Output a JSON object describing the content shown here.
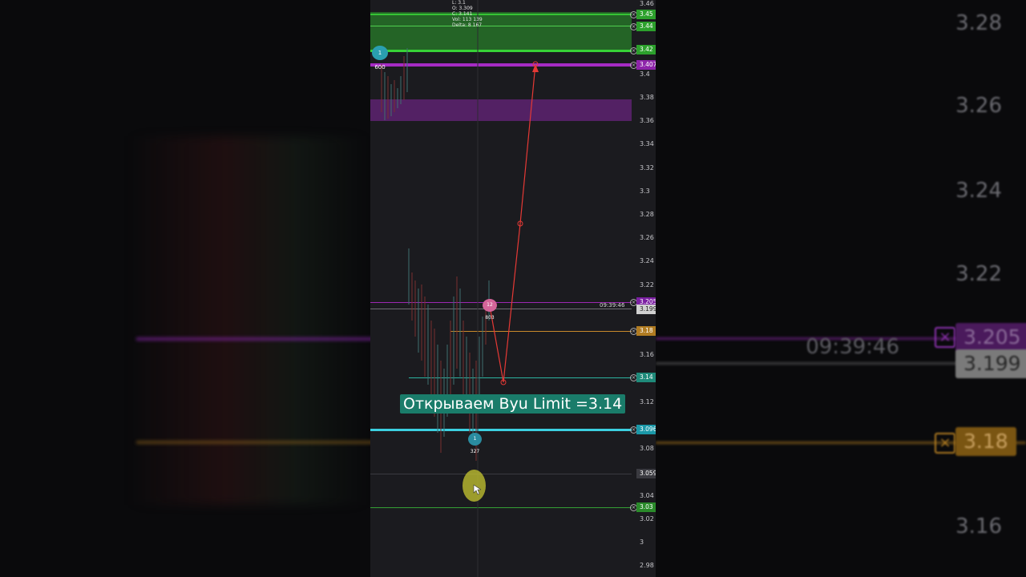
{
  "background": {
    "prices": [
      "3.28",
      "3.26",
      "3.24",
      "3.22",
      "3.16"
    ],
    "timer": "09:39:46",
    "tag_purple": "3.205",
    "tag_grey": "3.199",
    "tag_orange": "3.18"
  },
  "ohlc": {
    "low": "L: 3.1",
    "open": "O: 3.309",
    "close": "C: 3.141",
    "volume": "Vol: 113 139",
    "delta": "Delta: 8 167"
  },
  "axis_ticks": [
    "3.46",
    "3.4",
    "3.38",
    "3.36",
    "3.34",
    "3.32",
    "3.3",
    "3.28",
    "3.26",
    "3.24",
    "3.22",
    "3.16",
    "3.12",
    "3.08",
    "3.04",
    "3.02",
    "3",
    "2.98"
  ],
  "price_tags": {
    "green_top": "3.45",
    "green_mid": "3.44",
    "green_bottom": "3.42",
    "target": "3.407",
    "purple_line": "3.205",
    "current": "3.199",
    "orange": "3.18",
    "entry": "3.14",
    "cyan": "3.096",
    "grey": "3.059",
    "green_low": "3.03"
  },
  "badges": {
    "top_left": "1 600",
    "mid": "12 803",
    "bottom": "1 327"
  },
  "countdown": "09:39:46",
  "caption": "Открываем Byu Limit =3.14",
  "colors": {
    "green_zone": "#2ca02c",
    "purple": "#9c27b0",
    "cyan": "#26c6da",
    "orange": "#c98a2a",
    "teal": "#1a7c6a",
    "path": "#e53935"
  }
}
